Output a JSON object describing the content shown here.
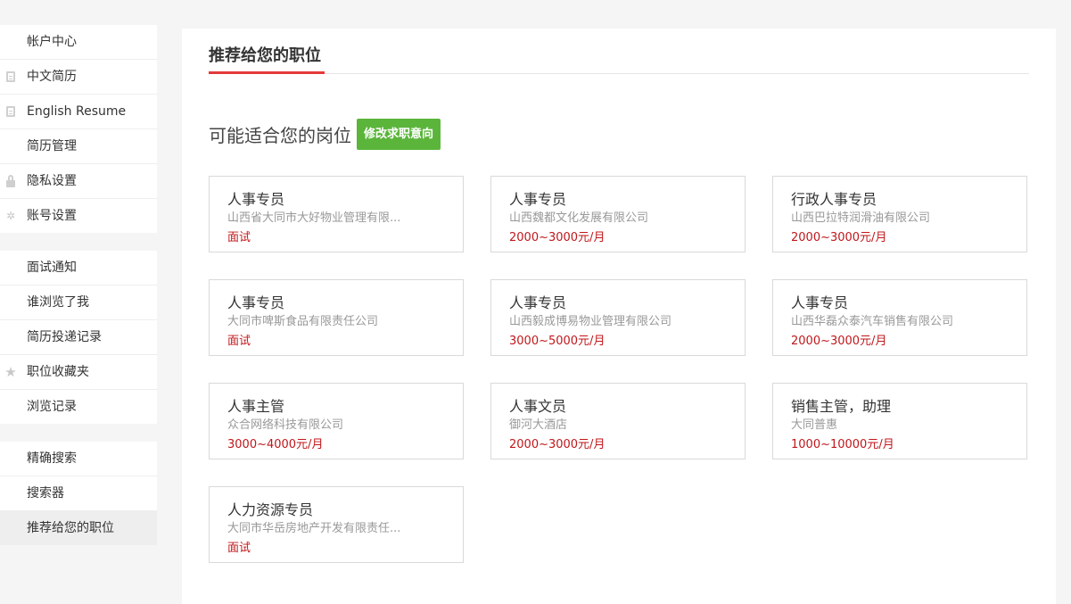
{
  "sidebar": {
    "groups": [
      [
        {
          "label": "帐户中心",
          "icon": ""
        },
        {
          "label": "中文简历",
          "icon": "document-icon"
        },
        {
          "label": "English Resume",
          "icon": "document-icon"
        },
        {
          "label": "简历管理",
          "icon": ""
        },
        {
          "label": "隐私设置",
          "icon": "lock-icon"
        },
        {
          "label": "账号设置",
          "icon": "gear-icon"
        }
      ],
      [
        {
          "label": "面试通知",
          "icon": ""
        },
        {
          "label": "谁浏览了我",
          "icon": ""
        },
        {
          "label": "简历投递记录",
          "icon": ""
        },
        {
          "label": "职位收藏夹",
          "icon": "star-icon"
        },
        {
          "label": "浏览记录",
          "icon": ""
        }
      ],
      [
        {
          "label": "精确搜索",
          "icon": ""
        },
        {
          "label": "搜索器",
          "icon": ""
        },
        {
          "label": "推荐给您的职位",
          "icon": "",
          "active": true
        }
      ]
    ]
  },
  "main": {
    "title": "推荐给您的职位",
    "subtitle": "可能适合您的岗位",
    "edit_button": "修改求职意向"
  },
  "jobs": [
    {
      "title": "人事专员",
      "company": "山西省大同市大好物业管理有限...",
      "salary": "面试"
    },
    {
      "title": "人事专员",
      "company": "山西魏都文化发展有限公司",
      "salary": "2000~3000元/月"
    },
    {
      "title": "行政人事专员",
      "company": "山西巴拉特润滑油有限公司",
      "salary": "2000~3000元/月"
    },
    {
      "title": "人事专员",
      "company": "大同市啤斯食品有限责任公司",
      "salary": "面试"
    },
    {
      "title": "人事专员",
      "company": "山西毅成博易物业管理有限公司",
      "salary": "3000~5000元/月"
    },
    {
      "title": "人事专员",
      "company": "山西华磊众泰汽车销售有限公司",
      "salary": "2000~3000元/月"
    },
    {
      "title": "人事主管",
      "company": "众合网络科技有限公司",
      "salary": "3000~4000元/月"
    },
    {
      "title": "人事文员",
      "company": "御河大酒店",
      "salary": "2000~3000元/月"
    },
    {
      "title": "销售主管，助理",
      "company": "大同普惠",
      "salary": "1000~10000元/月"
    },
    {
      "title": "人力资源专员",
      "company": "大同市华岳房地产开发有限责任...",
      "salary": "面试"
    }
  ],
  "colors": {
    "accent": "#e4393c",
    "button": "#5bb53b",
    "salary": "#c0171b"
  }
}
